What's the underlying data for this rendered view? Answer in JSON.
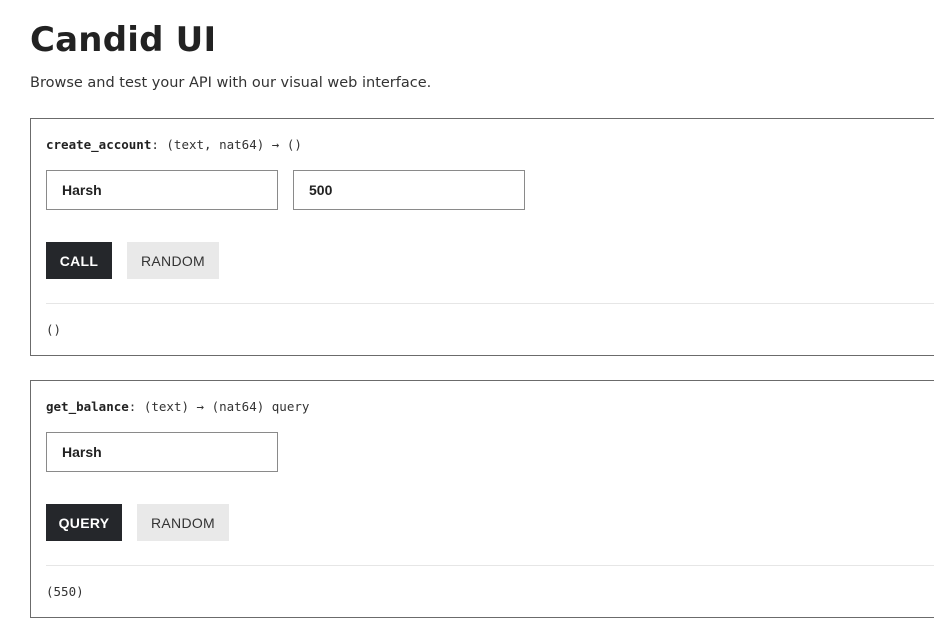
{
  "header": {
    "title": "Candid UI",
    "subtitle": "Browse and test your API with our visual web interface."
  },
  "methods": [
    {
      "name": "create_account",
      "signature": ": (text, nat64) → ()",
      "inputs": [
        "Harsh",
        "500"
      ],
      "primary_label": "CALL",
      "random_label": "RANDOM",
      "result": "()"
    },
    {
      "name": "get_balance",
      "signature": ": (text) → (nat64) query",
      "inputs": [
        "Harsh"
      ],
      "primary_label": "QUERY",
      "random_label": "RANDOM",
      "result": "(550)"
    }
  ],
  "colors": {
    "primary_button": "#25272b",
    "secondary_button": "#e9e9e9",
    "card_border": "#6b6b6b"
  }
}
